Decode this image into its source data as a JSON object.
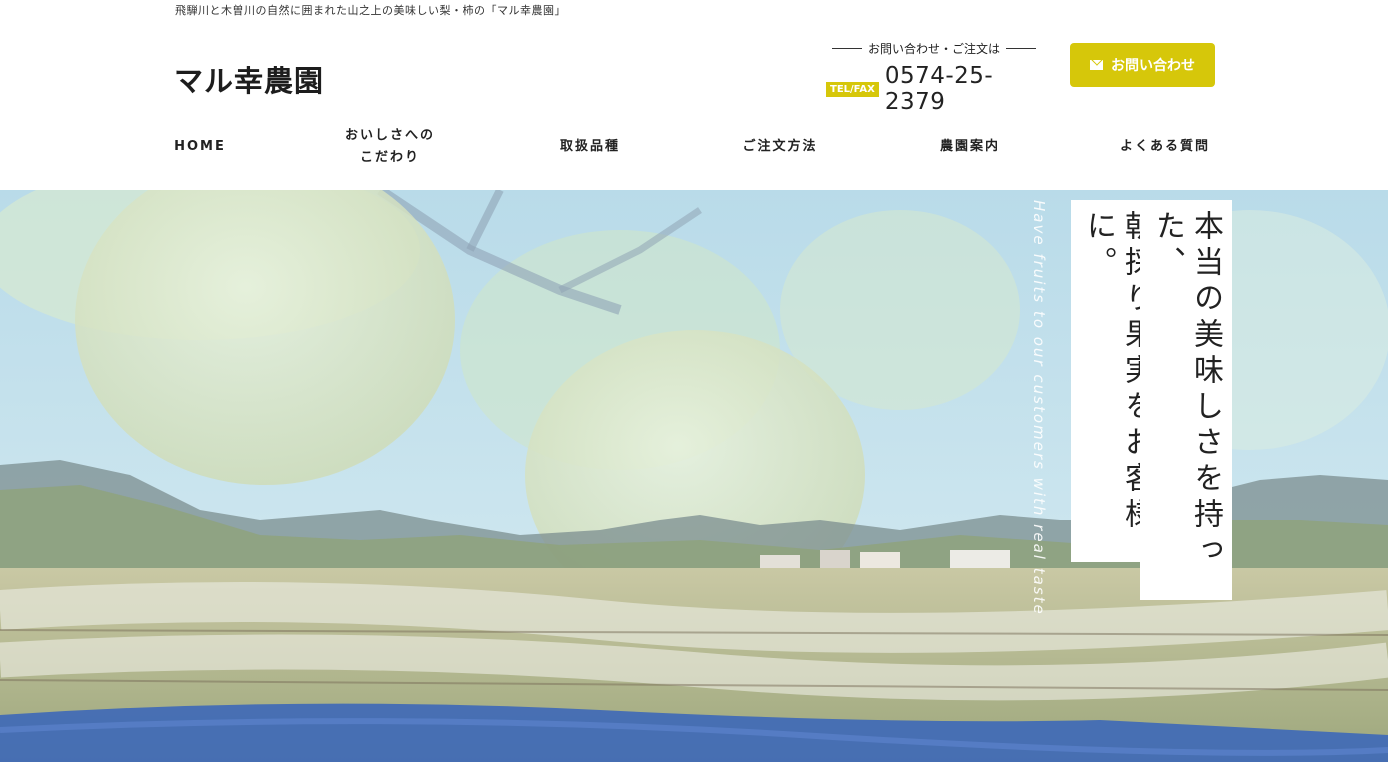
{
  "header": {
    "tagline": "飛騨川と木曽川の自然に囲まれた山之上の美味しい梨・柿の「マル幸農園」",
    "logo": "マル幸農園",
    "contact_label": "お問い合わせ・ご注文は",
    "tel_badge": "TEL/FAX",
    "tel_number": "0574-25-2379",
    "contact_button": "お問い合わせ"
  },
  "nav": [
    {
      "label": "HOME"
    },
    {
      "label": "おいしさへの\nこだわり"
    },
    {
      "label": "取扱品種"
    },
    {
      "label": "ご注文方法"
    },
    {
      "label": "農園案内"
    },
    {
      "label": "よくある質問"
    }
  ],
  "hero": {
    "copy_right": "本当の美味しさを持った、",
    "copy_left": "朝採り果実をお客様に。",
    "english_copy": "Have fruits to our customers with real taste"
  },
  "colors": {
    "accent": "#d6c70a"
  }
}
